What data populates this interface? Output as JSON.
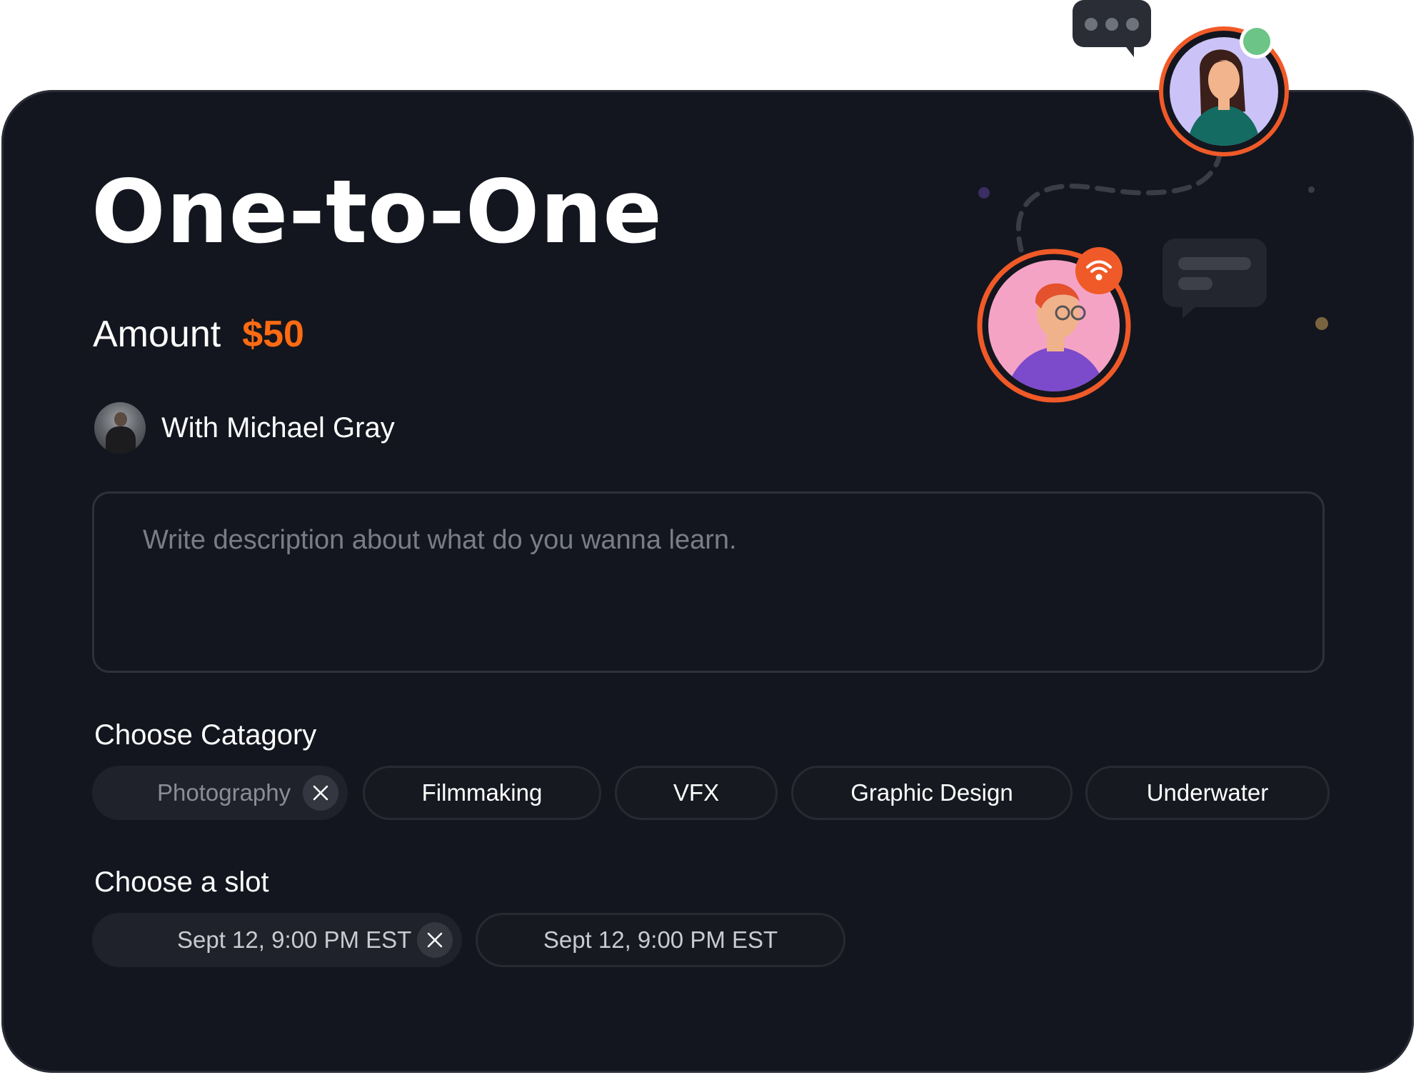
{
  "title": "One-to-One",
  "amount": {
    "label": "Amount",
    "value": "$50"
  },
  "mentor": {
    "name_text": "With Michael Gray"
  },
  "description": {
    "placeholder": "Write description about what do you wanna learn.",
    "value": ""
  },
  "category": {
    "heading": "Choose Catagory",
    "options": [
      {
        "label": "Photography",
        "selected": true
      },
      {
        "label": "Filmmaking",
        "selected": false
      },
      {
        "label": "VFX",
        "selected": false
      },
      {
        "label": "Graphic Design",
        "selected": false
      },
      {
        "label": "Underwater",
        "selected": false
      }
    ]
  },
  "slot": {
    "heading": "Choose a slot",
    "options": [
      {
        "label": "Sept 12, 9:00 PM EST",
        "selected": true
      },
      {
        "label": "Sept 12, 9:00 PM EST",
        "selected": false
      }
    ]
  },
  "colors": {
    "card_background": "#13161e",
    "accent": "#ff6b12",
    "online_status": "#6cc486"
  },
  "icons": {
    "chip_remove": "close-icon",
    "typing_bubble": "chat-bubble-typing-icon",
    "message_bubble": "chat-bubble-icon",
    "live": "wifi-icon"
  }
}
